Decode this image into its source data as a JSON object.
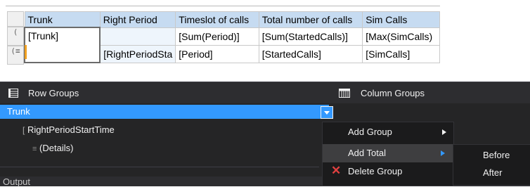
{
  "tablix": {
    "headers": [
      "Trunk",
      "Right Period",
      "Timeslot of calls",
      "Total number of calls",
      "Sim Calls"
    ],
    "row1": [
      "[Trunk]",
      "",
      "[Sum(Period)]",
      "[Sum(StartedCalls)]",
      "[Max(SimCalls)"
    ],
    "row2": [
      "",
      "[RightPeriodSta",
      "[Period]",
      "[StartedCalls]",
      "[SimCalls]"
    ],
    "handle_row1": "(",
    "handle_row2": "(≡"
  },
  "row_groups": {
    "title": "Row Groups",
    "items": [
      {
        "label": "Trunk",
        "marker": "≡"
      },
      {
        "label": "RightPeriodStartTime",
        "marker": "["
      },
      {
        "label": "(Details)",
        "marker": "≡"
      }
    ]
  },
  "column_groups": {
    "title": "Column Groups"
  },
  "context_menu": {
    "items": [
      {
        "label": "Add Group",
        "has_submenu": true
      },
      {
        "label": "Add Total",
        "has_submenu": true
      },
      {
        "label": "Delete Group",
        "icon": "delete-icon"
      }
    ]
  },
  "submenu": {
    "items": [
      "Before",
      "After"
    ]
  },
  "output": {
    "label": "Output"
  },
  "colors": {
    "accent": "#3399ff",
    "header_blue": "#c6dbf1",
    "pane_bg": "#252526"
  }
}
